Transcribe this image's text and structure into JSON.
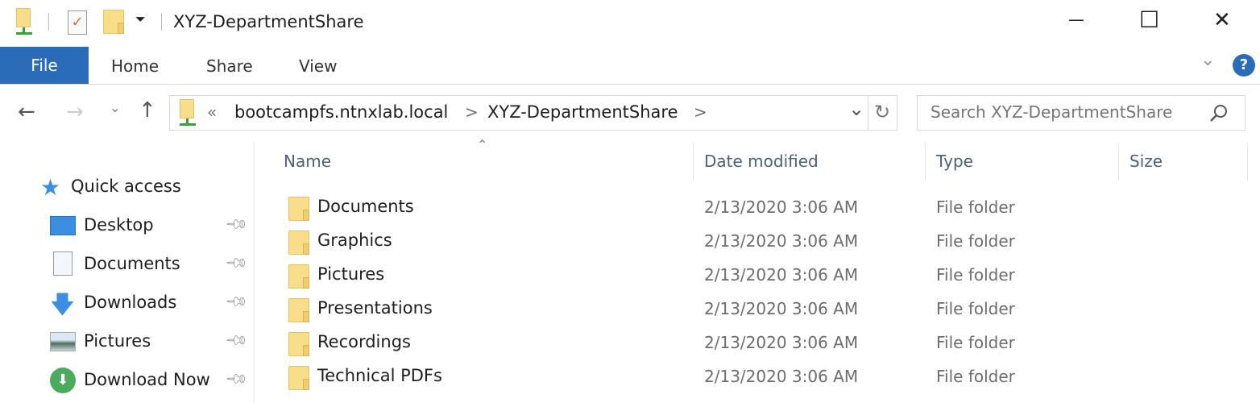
{
  "window": {
    "title": "XYZ-DepartmentShare",
    "minimize": "—",
    "maximize": "☐",
    "close": "✕"
  },
  "ribbon": {
    "tabs": [
      "File",
      "Home",
      "Share",
      "View"
    ],
    "help": "?",
    "expand": "⌄"
  },
  "nav": {
    "back": "←",
    "forward": "→",
    "recent": "⌄",
    "up": "↑",
    "overflow": "«",
    "crumbs": [
      "bootcampfs.ntnxlab.local",
      "XYZ-DepartmentShare"
    ],
    "sep": ">",
    "dropdown": "⌄",
    "refresh": "↻"
  },
  "search": {
    "placeholder": "Search XYZ-DepartmentShare"
  },
  "sidebar": {
    "quick_access": "Quick access",
    "items": [
      {
        "label": "Desktop",
        "icon": "desktop-icon"
      },
      {
        "label": "Documents",
        "icon": "documents-icon"
      },
      {
        "label": "Downloads",
        "icon": "downloads-icon"
      },
      {
        "label": "Pictures",
        "icon": "pictures-icon"
      },
      {
        "label": "Download Now",
        "icon": "download-now-icon"
      }
    ]
  },
  "columns": {
    "name": "Name",
    "date": "Date modified",
    "type": "Type",
    "size": "Size"
  },
  "files": [
    {
      "name": "Documents",
      "date": "2/13/2020 3:06 AM",
      "type": "File folder"
    },
    {
      "name": "Graphics",
      "date": "2/13/2020 3:06 AM",
      "type": "File folder"
    },
    {
      "name": "Pictures",
      "date": "2/13/2020 3:06 AM",
      "type": "File folder"
    },
    {
      "name": "Presentations",
      "date": "2/13/2020 3:06 AM",
      "type": "File folder"
    },
    {
      "name": "Recordings",
      "date": "2/13/2020 3:06 AM",
      "type": "File folder"
    },
    {
      "name": "Technical PDFs",
      "date": "2/13/2020 3:06 AM",
      "type": "File folder"
    }
  ]
}
